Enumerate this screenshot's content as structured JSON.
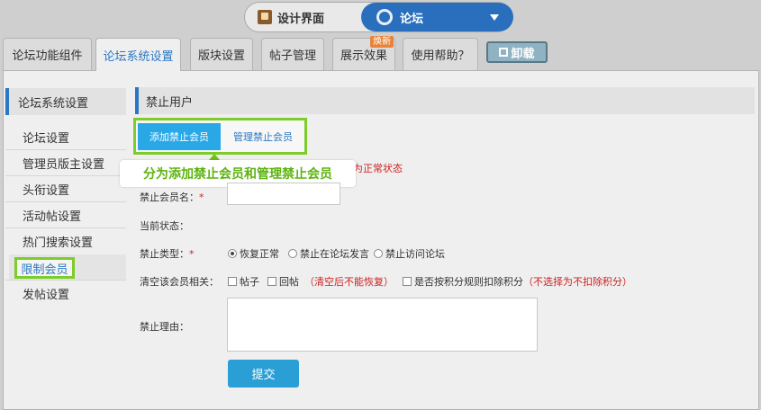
{
  "switcher": {
    "design_label": "设计界面",
    "forum_label": "论坛"
  },
  "tabs": [
    {
      "label": "论坛功能组件"
    },
    {
      "label": "论坛系统设置"
    },
    {
      "label": "版块设置"
    },
    {
      "label": "帖子管理"
    },
    {
      "label": "展示效果"
    },
    {
      "label": "使用帮助？"
    }
  ],
  "new_badge": "焕新",
  "uninstall_label": "卸载",
  "sidebar": {
    "title": "论坛系统设置",
    "items": [
      "论坛设置",
      "管理员版主设置",
      "头衔设置",
      "活动帖设置",
      "热门搜索设置",
      "限制会员",
      "发帖设置"
    ]
  },
  "content": {
    "section_title": "禁止用户",
    "subtabs": {
      "add": "添加禁止会员",
      "manage": "管理禁止会员"
    },
    "callout": "分为添加禁止会员和管理禁止会员",
    "status_note_visible": "为正常状态",
    "form": {
      "member_name_label": "禁止会员名：",
      "current_status_label": "当前状态：",
      "ban_type_label": "禁止类型：",
      "ban_options": [
        "恢复正常",
        "禁止在论坛发言",
        "禁止访问论坛"
      ],
      "clear_label": "清空该会员相关：",
      "clear_options": [
        "帖子",
        "回帖"
      ],
      "irreversible_note": "（清空后不能恢复）",
      "deduct_label": "是否按积分规则扣除积分",
      "deduct_note": "（不选择为不扣除积分）",
      "reason_label": "禁止理由：",
      "submit_label": "提交",
      "required_mark": "*"
    }
  }
}
